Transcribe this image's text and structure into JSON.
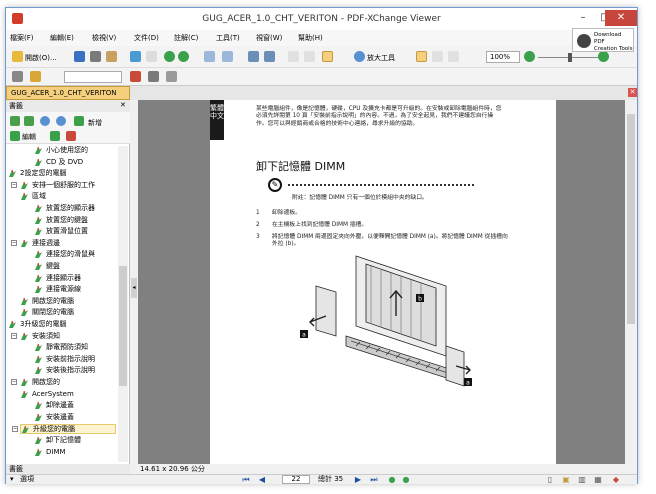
{
  "window": {
    "title": "GUG_ACER_1.0_CHT_VERITON - PDF-XChange Viewer",
    "minimize": "–",
    "maximize": "□",
    "close": "✕"
  },
  "menu": [
    "檔案(F)",
    "編輯(E)",
    "檢視(V)",
    "文件(D)",
    "註解(C)",
    "工具(T)",
    "視窗(W)",
    "幫助(H)"
  ],
  "download": {
    "line1": "Download PDF",
    "line2": "Creation Tools"
  },
  "toolbar": {
    "open_label": "開啟(O)...",
    "zoom_tool_label": "放大工具",
    "zoom_value": "100%"
  },
  "tab": {
    "label": "GUG_ACER_1.0_CHT_VERITON",
    "close": "✕"
  },
  "panel": {
    "title": "書籤",
    "close": "✕",
    "new_label": "新增",
    "edit_label": "編輯",
    "bottom_tab": "書籤"
  },
  "tree": [
    {
      "label": "小心使用您的",
      "level": 3,
      "exp": ""
    },
    {
      "label": "CD 及 DVD",
      "level": 3,
      "exp": ""
    },
    {
      "label": "2設定您的電腦",
      "level": 1,
      "exp": "−"
    },
    {
      "label": "安排一個舒服的工作",
      "level": 2,
      "exp": "−"
    },
    {
      "label": "區域",
      "level": 2,
      "exp": ""
    },
    {
      "label": "放置您的顯示器",
      "level": 3,
      "exp": ""
    },
    {
      "label": "放置您的鍵盤",
      "level": 3,
      "exp": ""
    },
    {
      "label": "放置滑鼠位置",
      "level": 3,
      "exp": ""
    },
    {
      "label": "連接週邊",
      "level": 2,
      "exp": "−"
    },
    {
      "label": "連接您的滑鼠與",
      "level": 3,
      "exp": ""
    },
    {
      "label": "鍵盤",
      "level": 3,
      "exp": ""
    },
    {
      "label": "連接顯示器",
      "level": 3,
      "exp": ""
    },
    {
      "label": "連接電源線",
      "level": 3,
      "exp": ""
    },
    {
      "label": "開啟您的電腦",
      "level": 2,
      "exp": ""
    },
    {
      "label": "關閉您的電腦",
      "level": 2,
      "exp": ""
    },
    {
      "label": "3升級您的電腦",
      "level": 1,
      "exp": "−"
    },
    {
      "label": "安裝須知",
      "level": 2,
      "exp": "−"
    },
    {
      "label": "靜電預防須知",
      "level": 3,
      "exp": ""
    },
    {
      "label": "安裝前指示說明",
      "level": 3,
      "exp": ""
    },
    {
      "label": "安裝後指示說明",
      "level": 3,
      "exp": ""
    },
    {
      "label": "開啟您的",
      "level": 2,
      "exp": "−"
    },
    {
      "label": "AcerSystem",
      "level": 2,
      "exp": ""
    },
    {
      "label": "卸除邊蓋",
      "level": 3,
      "exp": ""
    },
    {
      "label": "安裝邊蓋",
      "level": 3,
      "exp": ""
    },
    {
      "label": "升級您的電腦",
      "level": 2,
      "exp": "−",
      "selected": true
    },
    {
      "label": "卸下記憶體",
      "level": 3,
      "exp": ""
    },
    {
      "label": "DIMM",
      "level": 3,
      "exp": ""
    }
  ],
  "page": {
    "side_tab": "繁體中文",
    "intro": "某些電腦組件，像是記憶體，硬碟，CPU 及擴充卡都是可升級的。在安裝或卸除電腦組件時，您必須先詳閱第 10 頁「安裝前指示說明」的內容。不過，為了安全起見，我們不建議您自行操作。您可以與經銷商或合格的技術中心連絡，尋求升級的協助。",
    "heading": "卸下記憶體 DIMM",
    "note": "附註：記憶體 DIMM 只有一個位於模組中央的缺口。",
    "steps": [
      {
        "num": "1",
        "text": "卸除邊板。"
      },
      {
        "num": "2",
        "text": "在主機板上找到記憶體 DIMM 插槽。"
      },
      {
        "num": "3",
        "text": "將記憶體 DIMM 兩邊固定夾向外壓，以便釋開記憶體 DIMM (a)。將記憶體 DIMM 從插槽向外拉 (b)。"
      }
    ],
    "callout_a": "a",
    "callout_b": "b"
  },
  "status": {
    "page_size": "14.61 x 20.96 公分",
    "options": "選項",
    "current_page": "22",
    "total_pages": "總計 35"
  }
}
